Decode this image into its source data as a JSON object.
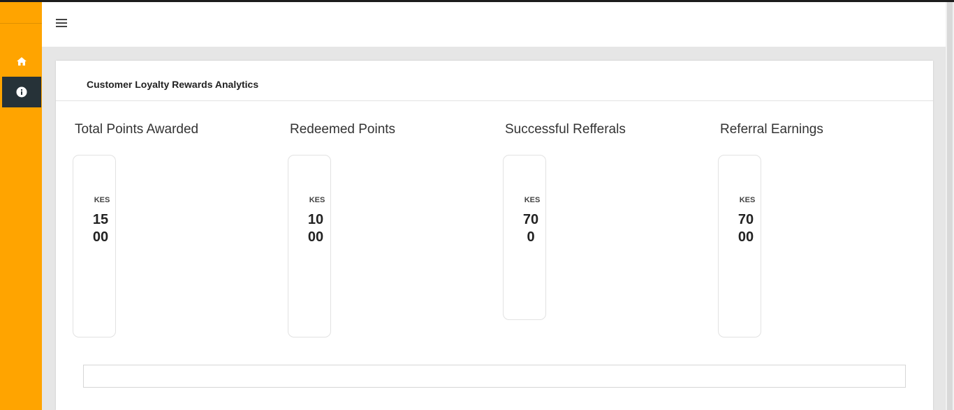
{
  "sidebar": {
    "items": [
      {
        "icon": "home-icon"
      },
      {
        "icon": "info-icon"
      }
    ]
  },
  "header": {
    "menu_icon": "hamburger-menu-icon"
  },
  "card": {
    "title": "Customer Loyalty Rewards Analytics"
  },
  "metrics": [
    {
      "label": "Total Points Awarded",
      "currency": "KES",
      "value": "1500"
    },
    {
      "label": "Redeemed Points",
      "currency": "KES",
      "value": "1000"
    },
    {
      "label": "Successful Refferals",
      "currency": "KES",
      "value": "700"
    },
    {
      "label": "Referral Earnings",
      "currency": "KES",
      "value": "7000"
    }
  ],
  "colors": {
    "sidebar": "#ffa400",
    "active_nav": "#263238",
    "background": "#e6e6e6"
  }
}
